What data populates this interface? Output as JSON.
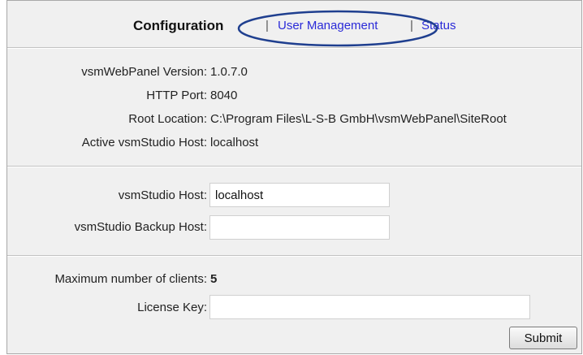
{
  "nav": {
    "title": "Configuration",
    "separator": "|",
    "links": [
      "User Management",
      "Status"
    ],
    "highlight_color": "#1f3f8f"
  },
  "info": [
    {
      "label": "vsmWebPanel Version:",
      "value": "1.0.7.0"
    },
    {
      "label": "HTTP Port:",
      "value": "8040"
    },
    {
      "label": "Root Location:",
      "value": "C:\\Program Files\\L-S-B GmbH\\vsmWebPanel\\SiteRoot"
    },
    {
      "label": "Active vsmStudio Host:",
      "value": "localhost"
    }
  ],
  "hosts": {
    "host_label": "vsmStudio Host:",
    "host_value": "localhost",
    "backup_label": "vsmStudio Backup Host:",
    "backup_value": ""
  },
  "license": {
    "max_clients_label": "Maximum number of clients:",
    "max_clients_value": "5",
    "key_label": "License Key:",
    "key_value": ""
  },
  "submit_label": "Submit",
  "colors": {
    "link": "#2a2ad8",
    "panel_bg": "#f0f0f0"
  }
}
